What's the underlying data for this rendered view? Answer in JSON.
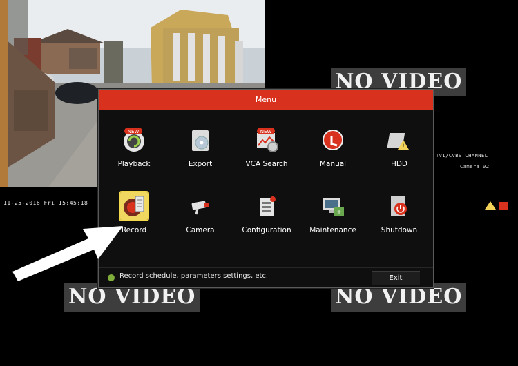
{
  "camera": {
    "timestamp": "11-25-2016 Fri 15:45:18"
  },
  "no_video_label": "NO VIDEO",
  "channel": {
    "title": "TVI/CVBS CHANNEL",
    "camera": "Camera 02"
  },
  "menu": {
    "title": "Menu",
    "items": [
      {
        "label": "Playback",
        "icon": "playback-icon",
        "badge": "NEW"
      },
      {
        "label": "Export",
        "icon": "export-icon"
      },
      {
        "label": "VCA Search",
        "icon": "vca-search-icon",
        "badge": "NEW"
      },
      {
        "label": "Manual",
        "icon": "manual-record-icon"
      },
      {
        "label": "HDD",
        "icon": "hdd-icon"
      },
      {
        "label": "Record",
        "icon": "record-icon",
        "selected": true
      },
      {
        "label": "Camera",
        "icon": "camera-icon"
      },
      {
        "label": "Configuration",
        "icon": "configuration-icon"
      },
      {
        "label": "Maintenance",
        "icon": "maintenance-icon"
      },
      {
        "label": "Shutdown",
        "icon": "shutdown-icon"
      }
    ],
    "hint": "Record schedule, parameters settings, etc.",
    "exit_label": "Exit"
  },
  "colors": {
    "header": "#d8321e",
    "selected": "#f0d760",
    "hint_dot": "#7fae3a"
  }
}
